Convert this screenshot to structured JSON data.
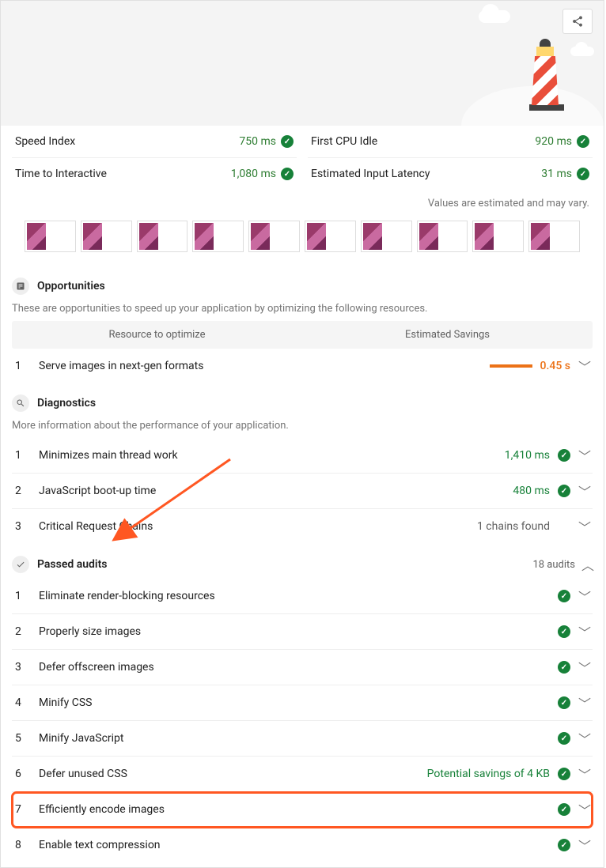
{
  "metrics": {
    "left": [
      {
        "label": "Speed Index",
        "value": "750 ms"
      },
      {
        "label": "Time to Interactive",
        "value": "1,080 ms"
      }
    ],
    "right": [
      {
        "label": "First CPU Idle",
        "value": "920 ms"
      },
      {
        "label": "Estimated Input Latency",
        "value": "31 ms"
      }
    ]
  },
  "estimated_note": "Values are estimated and may vary.",
  "opportunities": {
    "title": "Opportunities",
    "desc": "These are opportunities to speed up your application by optimizing the following resources.",
    "columns": {
      "left": "Resource to optimize",
      "right": "Estimated Savings"
    },
    "items": [
      {
        "idx": "1",
        "title": "Serve images in next-gen formats",
        "savings": "0.45 s"
      }
    ]
  },
  "diagnostics": {
    "title": "Diagnostics",
    "desc": "More information about the performance of your application.",
    "items": [
      {
        "idx": "1",
        "title": "Minimizes main thread work",
        "value": "1,410 ms",
        "pass": true
      },
      {
        "idx": "2",
        "title": "JavaScript boot-up time",
        "value": "480 ms",
        "pass": true
      },
      {
        "idx": "3",
        "title": "Critical Request Chains",
        "value": "1 chains found",
        "pass": false
      }
    ]
  },
  "passed": {
    "title": "Passed audits",
    "count_label": "18 audits",
    "items": [
      {
        "idx": "1",
        "title": "Eliminate render-blocking resources"
      },
      {
        "idx": "2",
        "title": "Properly size images"
      },
      {
        "idx": "3",
        "title": "Defer offscreen images"
      },
      {
        "idx": "4",
        "title": "Minify CSS"
      },
      {
        "idx": "5",
        "title": "Minify JavaScript"
      },
      {
        "idx": "6",
        "title": "Defer unused CSS",
        "extra": "Potential savings of 4 KB"
      },
      {
        "idx": "7",
        "title": "Efficiently encode images",
        "highlight": true
      },
      {
        "idx": "8",
        "title": "Enable text compression"
      }
    ]
  }
}
